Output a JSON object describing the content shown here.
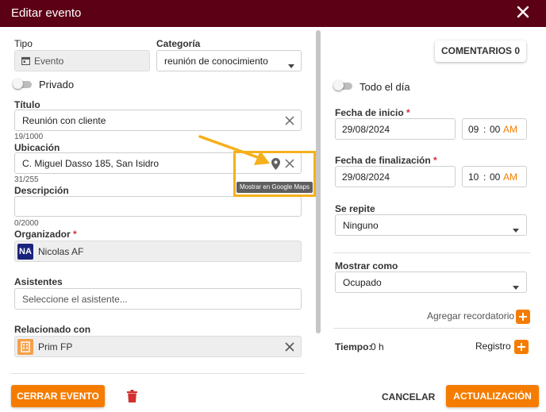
{
  "dialog": {
    "title": "Editar evento"
  },
  "left": {
    "tipo_label": "Tipo",
    "tipo_value": "Evento",
    "categoria_label": "Categoría",
    "categoria_value": "reunión de conocimiento",
    "privado_label": "Privado",
    "privado_on": false,
    "titulo_label": "Título",
    "titulo_value": "Reunión con cliente",
    "titulo_counter": "19/1000",
    "ubicacion_label": "Ubicación",
    "ubicacion_value": "C. Miguel Dasso 185, San Isidro",
    "ubicacion_counter": "31/255",
    "maps_tooltip": "Mostrar en Google Maps",
    "descripcion_label": "Descripción",
    "descripcion_value": "",
    "descripcion_counter": "0/2000",
    "organizador_label": "Organizador",
    "organizador_initials": "NA",
    "organizador_value": "Nicolas AF",
    "asistentes_label": "Asistentes",
    "asistentes_placeholder": "Seleccione el asistente...",
    "relacionado_label": "Relacionado con",
    "relacionado_value": "Prim FP",
    "required_mark": "*"
  },
  "right": {
    "comentarios_button": "COMENTARIOS 0",
    "todo_dia_label": "Todo el día",
    "todo_dia_on": false,
    "inicio_label": "Fecha de inicio",
    "inicio_date": "29/08/2024",
    "inicio_hour": "09",
    "inicio_min": "00",
    "inicio_ampm": "AM",
    "fin_label": "Fecha de finalización",
    "fin_date": "29/08/2024",
    "fin_hour": "10",
    "fin_min": "00",
    "fin_ampm": "AM",
    "time_sep": ":",
    "repite_label": "Se repite",
    "repite_value": "Ninguno",
    "mostrar_label": "Mostrar como",
    "mostrar_value": "Ocupado",
    "recordatorio_label": "Agregar recordatorio",
    "tiempo_label": "Tiempo:",
    "tiempo_value": "0 h",
    "registro_label": "Registro"
  },
  "footer": {
    "cerrar_button": "CERRAR EVENTO",
    "cancelar_button": "CANCELAR",
    "actualizar_button": "ACTUALIZACIÓN"
  },
  "colors": {
    "titlebar": "#5c0015",
    "accent": "#f57c00",
    "annotation": "#f5b01c",
    "delete": "#d32f2f",
    "avatar": "#1a237e"
  }
}
